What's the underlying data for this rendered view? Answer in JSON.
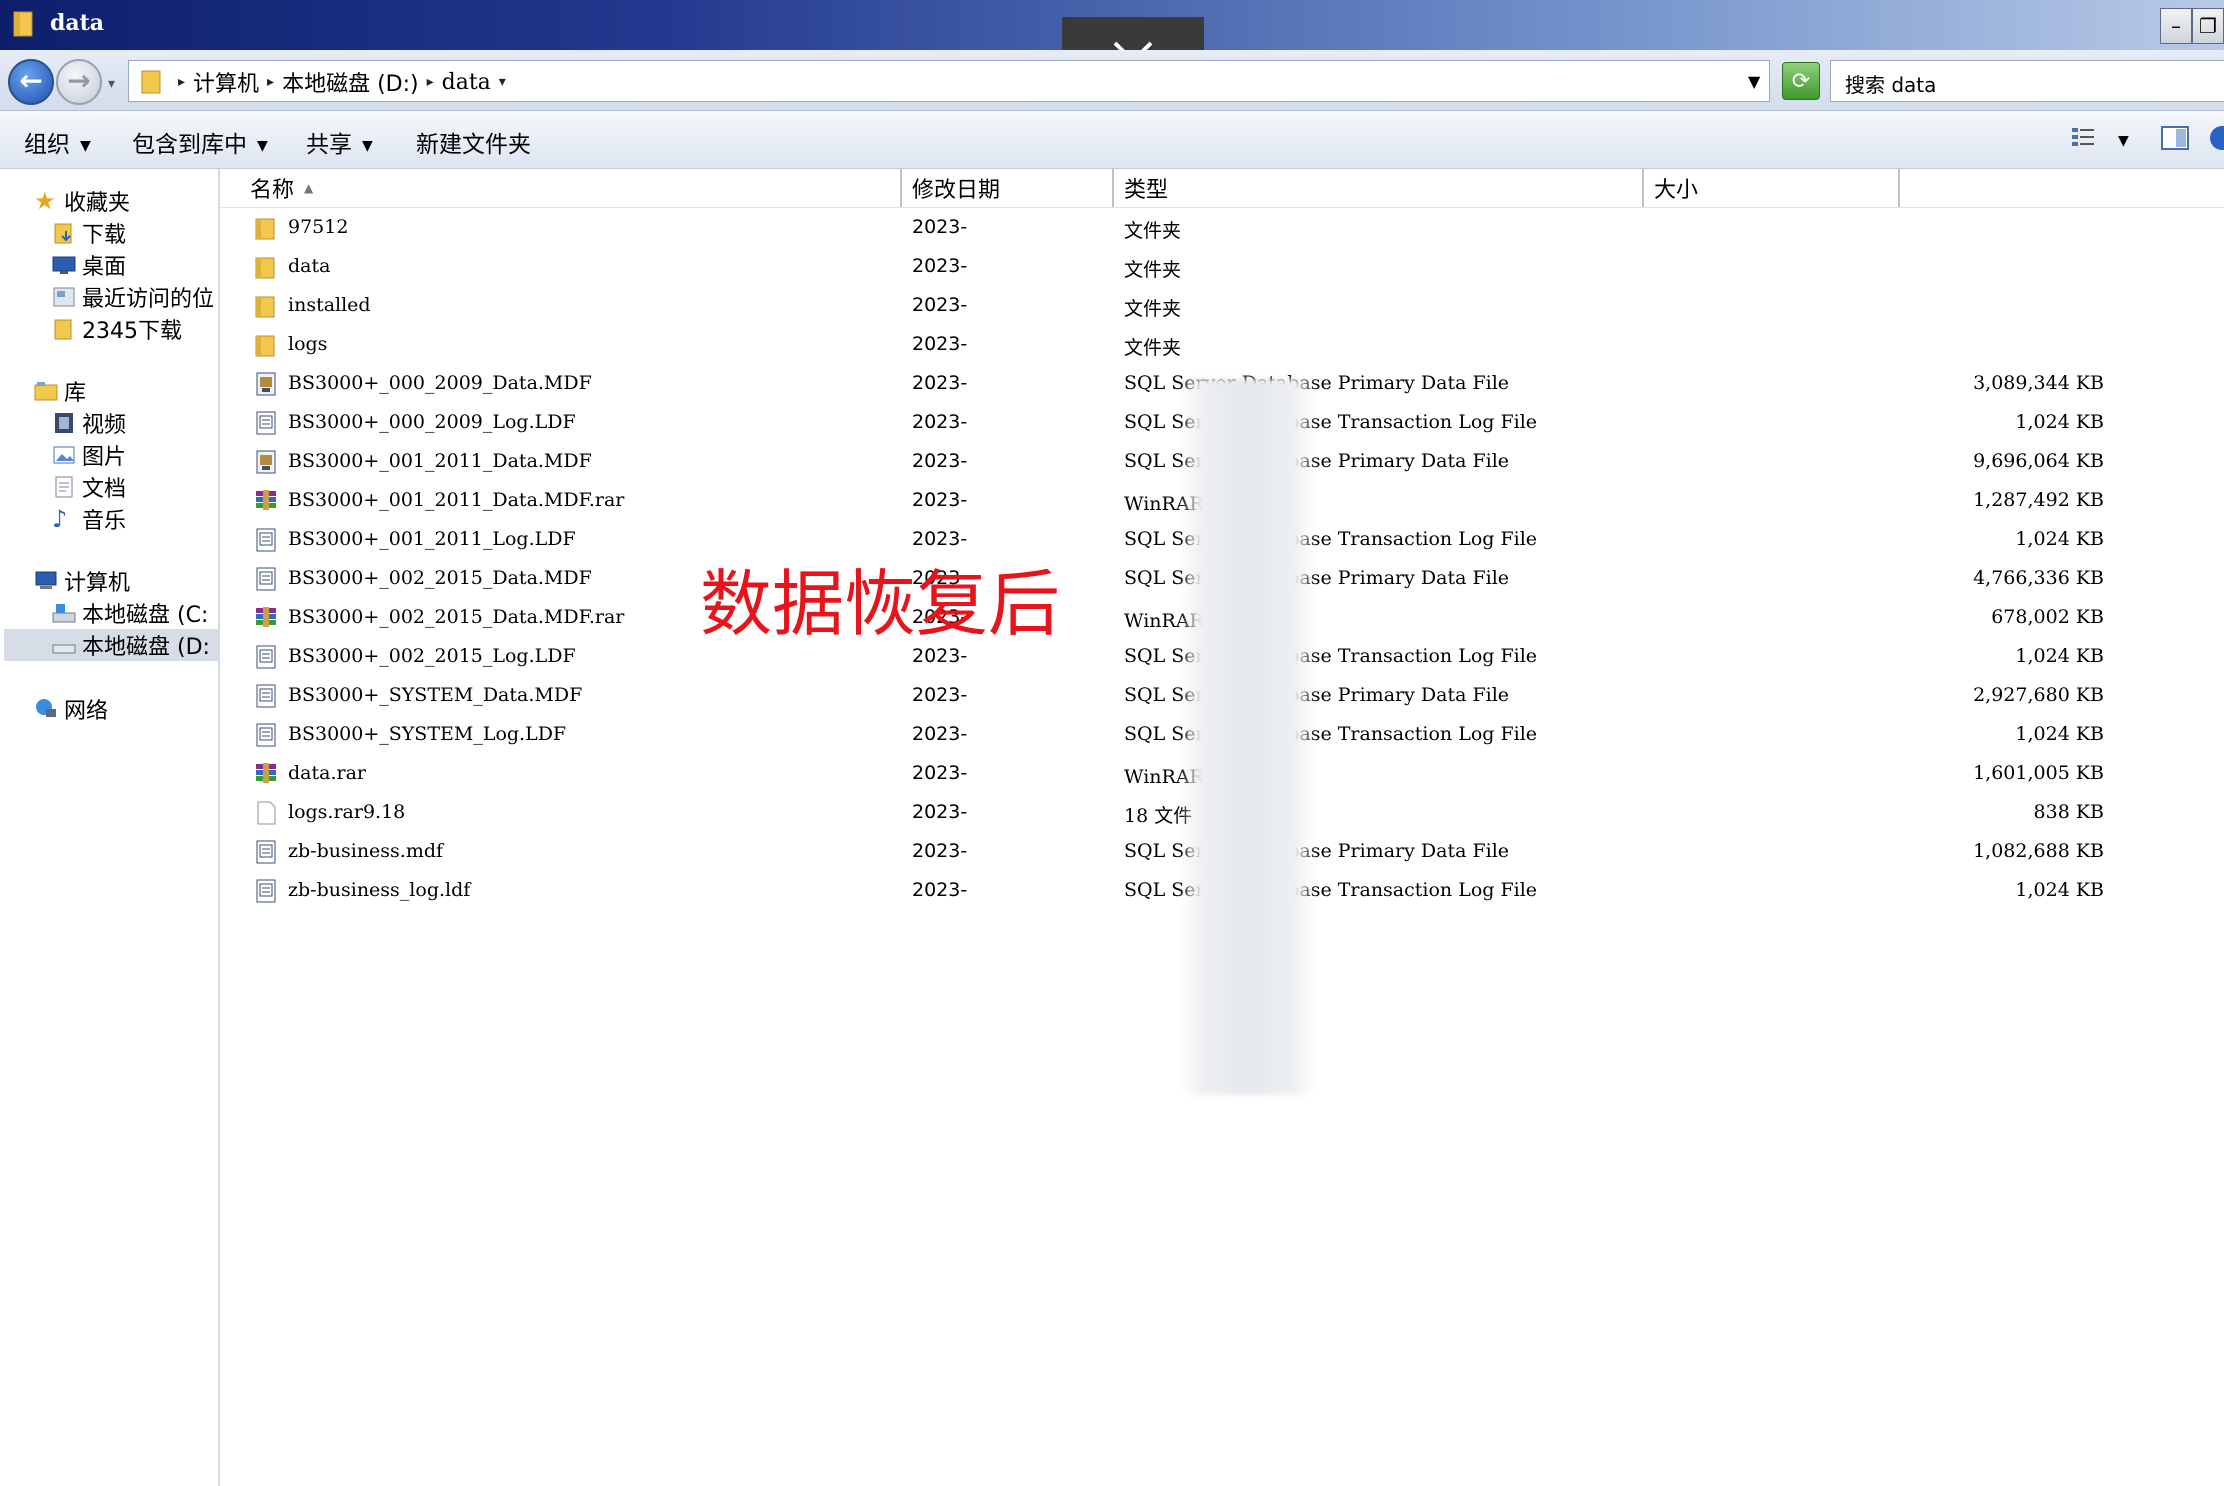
{
  "window": {
    "title": "data"
  },
  "nav": {
    "breadcrumbs": [
      "计算机",
      "本地磁盘 (D:)",
      "data"
    ],
    "search_placeholder": "搜索 data"
  },
  "toolbar": {
    "organize": "组织",
    "include_library": "包含到库中",
    "share": "共享",
    "new_folder": "新建文件夹"
  },
  "sidebar": {
    "favorites": "收藏夹",
    "fav_items": [
      "下载",
      "桌面",
      "最近访问的位",
      "2345下载"
    ],
    "libraries": "库",
    "lib_items": [
      "视频",
      "图片",
      "文档",
      "音乐"
    ],
    "computer": "计算机",
    "drives": [
      "本地磁盘 (C:",
      "本地磁盘 (D:"
    ],
    "network": "网络"
  },
  "columns": {
    "name": "名称",
    "date": "修改日期",
    "type": "类型",
    "size": "大小"
  },
  "files": [
    {
      "name": "97512",
      "date": "2023-",
      "type": "文件夹",
      "size": "",
      "icon": "folder-icon"
    },
    {
      "name": "data",
      "date": "2023-",
      "type": "文件夹",
      "size": "",
      "icon": "folder-icon"
    },
    {
      "name": "installed",
      "date": "2023-",
      "type": "文件夹",
      "size": "",
      "icon": "folder-icon"
    },
    {
      "name": "logs",
      "date": "2023-",
      "type": "文件夹",
      "size": "",
      "icon": "folder-icon"
    },
    {
      "name": "BS3000+_000_2009_Data.MDF",
      "date": "2023-",
      "type": "SQL Server Database Primary Data File",
      "size": "3,089,344 KB",
      "icon": "mdf-icon"
    },
    {
      "name": "BS3000+_000_2009_Log.LDF",
      "date": "2023-",
      "type": "SQL Server Database Transaction Log File",
      "size": "1,024 KB",
      "icon": "ldf-icon"
    },
    {
      "name": "BS3000+_001_2011_Data.MDF",
      "date": "2023-",
      "type": "SQL Server Database Primary Data File",
      "size": "9,696,064 KB",
      "icon": "mdf-icon"
    },
    {
      "name": "BS3000+_001_2011_Data.MDF.rar",
      "date": "2023-",
      "type": "WinRAR 压缩文件",
      "size": "1,287,492 KB",
      "icon": "rar-icon"
    },
    {
      "name": "BS3000+_001_2011_Log.LDF",
      "date": "2023-",
      "type": "SQL Server Database Transaction Log File",
      "size": "1,024 KB",
      "icon": "ldf-icon"
    },
    {
      "name": "BS3000+_002_2015_Data.MDF",
      "date": "2023-",
      "type": "SQL Server Database Primary Data File",
      "size": "4,766,336 KB",
      "icon": "ldf-icon"
    },
    {
      "name": "BS3000+_002_2015_Data.MDF.rar",
      "date": "2023-",
      "type": "WinRAR 压缩文件",
      "size": "678,002 KB",
      "icon": "rar-icon"
    },
    {
      "name": "BS3000+_002_2015_Log.LDF",
      "date": "2023-",
      "type": "SQL Server Database Transaction Log File",
      "size": "1,024 KB",
      "icon": "ldf-icon"
    },
    {
      "name": "BS3000+_SYSTEM_Data.MDF",
      "date": "2023-",
      "type": "SQL Server Database Primary Data File",
      "size": "2,927,680 KB",
      "icon": "ldf-icon"
    },
    {
      "name": "BS3000+_SYSTEM_Log.LDF",
      "date": "2023-",
      "type": "SQL Server Database Transaction Log File",
      "size": "1,024 KB",
      "icon": "ldf-icon"
    },
    {
      "name": "data.rar",
      "date": "2023-",
      "type": "WinRAR 压缩文件",
      "size": "1,601,005 KB",
      "icon": "rar-icon"
    },
    {
      "name": "logs.rar9.18",
      "date": "2023-",
      "type": "18 文件",
      "size": "838 KB",
      "icon": "blank-file-icon"
    },
    {
      "name": "zb-business.mdf",
      "date": "2023-",
      "type": "SQL Server Database Primary Data File",
      "size": "1,082,688 KB",
      "icon": "ldf-icon"
    },
    {
      "name": "zb-business_log.ldf",
      "date": "2023-",
      "type": "SQL Server Database Transaction Log File",
      "size": "1,024 KB",
      "icon": "ldf-icon"
    }
  ],
  "overlay_text": "数据恢复后"
}
